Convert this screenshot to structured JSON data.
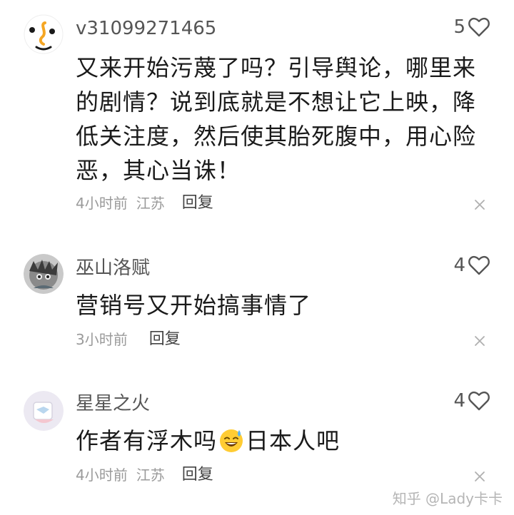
{
  "comments": [
    {
      "username": "v31099271465",
      "likes": "5",
      "text": "又来开始污蔑了吗？引导舆论，哪里来的剧情？说到底就是不想让它上映，降低关注度，然后使其胎死腹中，用心险恶，其心当诛！",
      "time": "4小时前",
      "location": "江苏",
      "reply_label": "回复"
    },
    {
      "username": "巫山洛赋",
      "likes": "4",
      "text": "营销号又开始搞事情了",
      "time": "3小时前",
      "location": "",
      "reply_label": "回复"
    },
    {
      "username": "星星之火",
      "likes": "4",
      "text_before_emoji": "作者有浮木吗",
      "emoji": "sweat-smile-emoji",
      "text_after_emoji": "日本人吧",
      "time": "4小时前",
      "location": "江苏",
      "reply_label": "回复"
    }
  ],
  "watermark": "知乎 @Lady卡卡",
  "icons": {
    "like": "heart-outline-icon",
    "dismiss": "close-icon"
  },
  "colors": {
    "text": "#1a1a1a",
    "secondary": "#555555",
    "meta": "#9a9a9a",
    "accent_orange": "#f5a623"
  }
}
